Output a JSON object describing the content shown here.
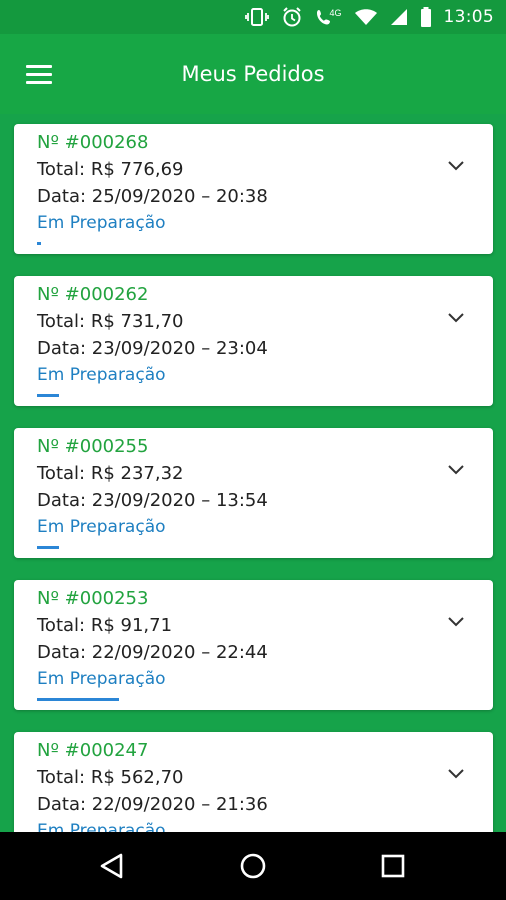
{
  "status_bar": {
    "time": "13:05",
    "network": "4G"
  },
  "app_bar": {
    "title": "Meus Pedidos"
  },
  "colors": {
    "primary": "#16a34a",
    "order_number": "#22a33f",
    "status": "#1e7fc1",
    "progress": "#2b86d6"
  },
  "orders": [
    {
      "number": "Nº #000268",
      "total": "Total: R$ 776,69",
      "date": "Data: 25/09/2020 – 20:38",
      "status": "Em Preparação",
      "progress": 0.01
    },
    {
      "number": "Nº #000262",
      "total": "Total: R$ 731,70",
      "date": "Data: 23/09/2020 – 23:04",
      "status": "Em Preparação",
      "progress": 0.05
    },
    {
      "number": "Nº #000255",
      "total": "Total: R$ 237,32",
      "date": "Data: 23/09/2020 – 13:54",
      "status": "Em Preparação",
      "progress": 0.05
    },
    {
      "number": "Nº #000253",
      "total": "Total: R$ 91,71",
      "date": "Data: 22/09/2020 – 22:44",
      "status": "Em Preparação",
      "progress": 0.19
    },
    {
      "number": "Nº #000247",
      "total": "Total: R$ 562,70",
      "date": "Data: 22/09/2020 – 21:36",
      "status": "Em Preparação",
      "progress": 0
    }
  ],
  "icons": {
    "menu": "hamburger-menu-icon",
    "expand": "chevron-down-icon",
    "back": "back-triangle-icon",
    "home": "home-circle-icon",
    "recents": "recents-square-icon"
  }
}
